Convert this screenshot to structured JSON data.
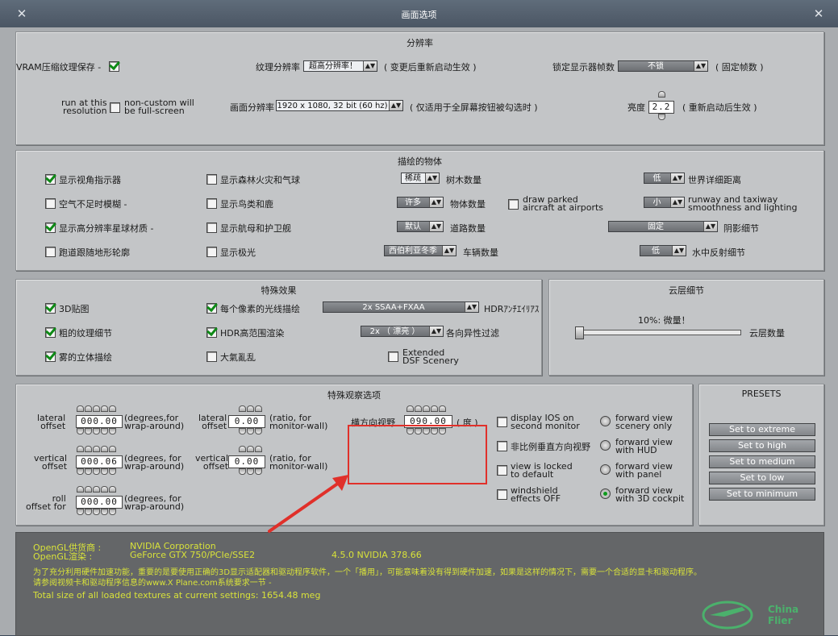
{
  "window": {
    "title": "画面选项"
  },
  "resolution": {
    "title": "分辨率",
    "vram_label": "VRAM压缩纹理保存 -",
    "vram_checked": true,
    "texture_label": "纹理分辨率",
    "texture_value": "超高分辨率！",
    "texture_note": "( 变更后重新启动生效 )",
    "lock_label": "锁定显示器帧数",
    "lock_value": "不锁",
    "lock_note": "( 固定帧数 )",
    "run_label": "run at this\nresolution",
    "run_checked": false,
    "noncustom_label": "non-custom will\nbe full-screen",
    "screen_label": "画面分辨率",
    "screen_value": "1920 x 1080, 32 bit (60 hz)",
    "screen_note": "( 仅适用于全屏幕按钮被勾选时 )",
    "brightness_label": "亮度",
    "brightness_value": "2.2",
    "brightness_note": "( 重新启动后生效 )"
  },
  "objects": {
    "title": "描绘的物体",
    "cb_show_view": {
      "label": "显示视角指示器",
      "checked": true
    },
    "cb_air": {
      "label": "空气不足时模糊 -",
      "checked": false
    },
    "cb_hires": {
      "label": "显示高分辨率星球材质 -",
      "checked": true
    },
    "cb_runway": {
      "label": "跑道跟随地形轮廓",
      "checked": false
    },
    "cb_fire": {
      "label": "显示森林火灾和气球",
      "checked": false
    },
    "cb_birds": {
      "label": "显示鸟类和鹿",
      "checked": false
    },
    "cb_carrier": {
      "label": "显示航母和护卫舰",
      "checked": false
    },
    "cb_aurora": {
      "label": "显示极光",
      "checked": false
    },
    "trees_value": "稀疏",
    "trees_label": "树木数量",
    "objects_value": "许多",
    "objects_label": "物体数量",
    "roads_value": "默认",
    "roads_label": "道路数量",
    "cars_value": "西伯利亚冬季",
    "cars_label": "车辆数量",
    "parked_label": "draw parked\naircraft at airports",
    "parked_checked": false,
    "world_value": "低",
    "world_label": "世界详细距离",
    "taxi_value": "小",
    "taxi_label": "runway and taxiway\nsmoothness and lighting",
    "shadow_value": "固定",
    "shadow_label": "阴影细节",
    "water_value": "低",
    "water_label": "水中反射细节"
  },
  "effects": {
    "title": "特殊效果",
    "cb_3d": {
      "label": "3D贴图",
      "checked": true
    },
    "cb_texture": {
      "label": "粗的纹理细节",
      "checked": true
    },
    "cb_fog": {
      "label": "雾的立体描绘",
      "checked": true
    },
    "cb_pixel": {
      "label": "每个像素的光线描绘",
      "checked": true
    },
    "cb_hdr": {
      "label": "HDR高范围渲染",
      "checked": true
    },
    "cb_turb": {
      "label": "大氣亂乱",
      "checked": false
    },
    "cb_dsf": {
      "label": "Extended\nDSF Scenery",
      "checked": false
    },
    "aa_value": "2x SSAA+FXAA",
    "aa_label": "HDRｱﾝﾁｴｲﾘｱｽ",
    "aniso_value": "2x （ 漂亮 ）",
    "aniso_label": "各向异性过滤"
  },
  "clouds": {
    "title": "云层细节",
    "value_text": "10%: 微量！",
    "level": 0.1,
    "label": "云层数量"
  },
  "view": {
    "title": "特殊观察选项",
    "lateral_offset_label": "lateral\noffset",
    "lateral_offset_value": "000.00",
    "lateral_offset_unit": "(degrees,for\nwrap-around)",
    "vertical_offset_label": "vertical\noffset",
    "vertical_offset_value": "000.06",
    "vertical_offset_unit": "(degrees, for\nwrap-around)",
    "roll_label": "roll\noffset for",
    "roll_value": "000.00",
    "roll_unit": "(degrees, for\nwrap-around)",
    "lateral_ratio_label": "lateral\noffset",
    "lateral_ratio_value": "0.00",
    "lateral_ratio_unit": "(ratio, for\nmonitor-wall)",
    "vertical_ratio_label": "vertical\noffset",
    "vertical_ratio_value": "0.00",
    "vertical_ratio_unit": "(ratio, for\nmonitor-wall)",
    "fov_label": "横方向视野",
    "fov_value": "090.00",
    "fov_unit": "( 度 )",
    "cb_ios": {
      "label": "display IOS on\nsecond monitor",
      "checked": false
    },
    "cb_nonprop": {
      "label": "非比例垂直方向视野",
      "checked": false
    },
    "cb_locked": {
      "label": "view is locked\nto default",
      "checked": false
    },
    "cb_windshield": {
      "label": "windshield\neffects OFF",
      "checked": false
    },
    "radio_scenery": {
      "label": "forward view\nscenery only",
      "checked": false
    },
    "radio_hud": {
      "label": "forward view\nwith HUD",
      "checked": false
    },
    "radio_panel": {
      "label": "forward view\nwith panel",
      "checked": false
    },
    "radio_cockpit": {
      "label": "forward view\nwith 3D cockpit",
      "checked": true
    }
  },
  "presets": {
    "title": "PRESETS",
    "extreme": "Set to extreme",
    "high": "Set to high",
    "medium": "Set to medium",
    "low": "Set to low",
    "minimum": "Set to minimum"
  },
  "info": {
    "vendor_label": "OpenGL供货商 :",
    "vendor_value": "NVIDIA Corporation",
    "renderer_label": "OpenGL渲染 :",
    "renderer_value": "GeForce GTX 750/PCIe/SSE2",
    "version_value": "4.5.0 NVIDIA 378.66",
    "line1": "为了充分利用硬件加速功能，重要的是要使用正确的3D显示适配器和驱动程序软件，一个「播用」，可能意味着没有得到硬件加速，如果是这样的情况下，需要一个合适的显卡和驱动程序。",
    "line2": "请参阅视频卡和驱动程序信息的www.X Plane.com系统要求一节 -",
    "line3": "Total size of all loaded textures at current settings: 1654.48 meg"
  },
  "watermark": {
    "text": "China Flier"
  },
  "colors": {
    "info_text": "#d8e23a",
    "check": "#0e8a16",
    "highlight": "#e0302a"
  }
}
